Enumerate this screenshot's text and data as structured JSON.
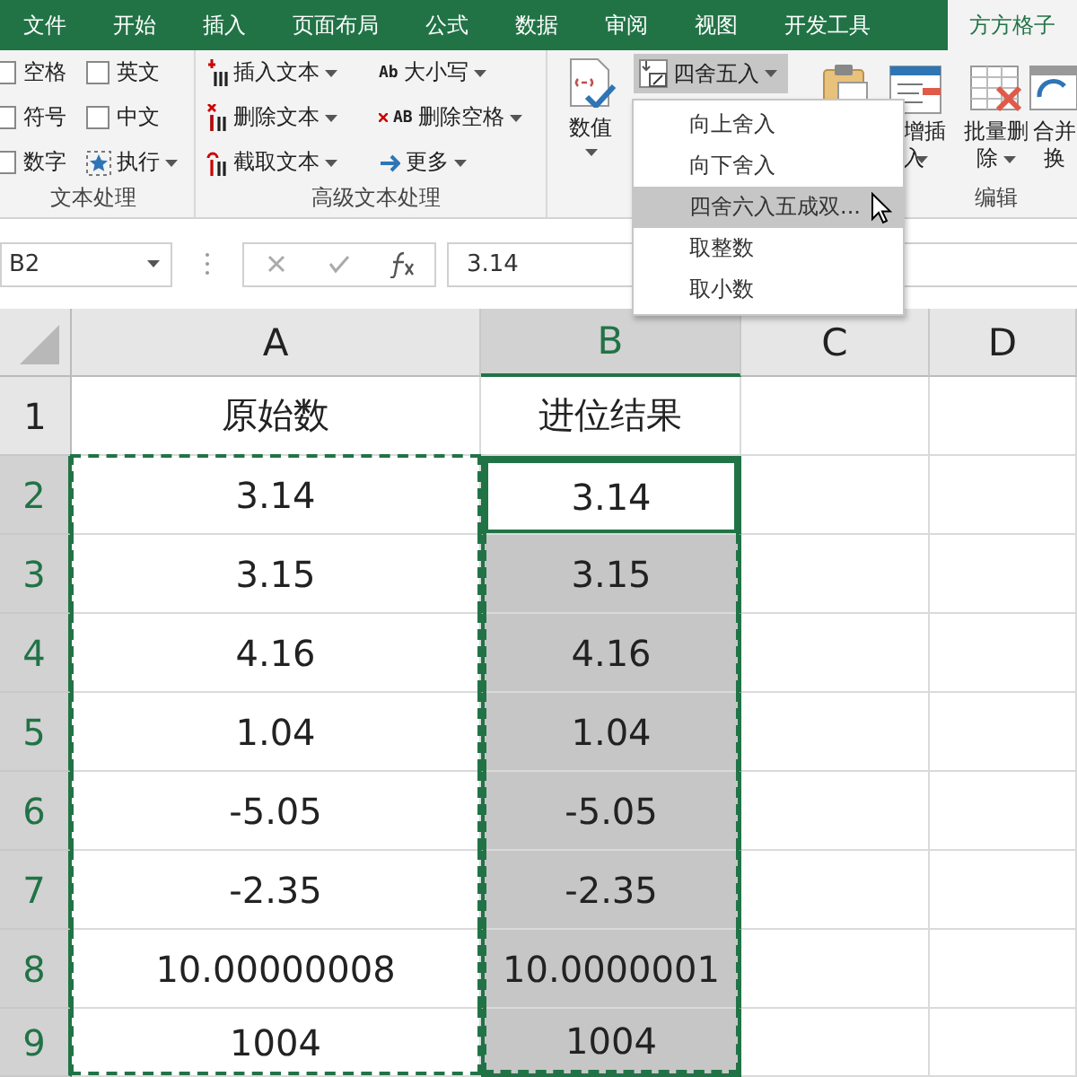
{
  "tabs": [
    {
      "label": "文件",
      "selected": false
    },
    {
      "label": "开始",
      "selected": false
    },
    {
      "label": "插入",
      "selected": false
    },
    {
      "label": "页面布局",
      "selected": false
    },
    {
      "label": "公式",
      "selected": false
    },
    {
      "label": "数据",
      "selected": false
    },
    {
      "label": "审阅",
      "selected": false
    },
    {
      "label": "视图",
      "selected": false
    },
    {
      "label": "开发工具",
      "selected": false
    },
    {
      "label": "方方格子",
      "selected": true
    }
  ],
  "ribbon": {
    "text_group": {
      "label": "文本处理",
      "checkboxes": [
        {
          "label": "空格",
          "checked": false
        },
        {
          "label": "英文",
          "checked": false
        },
        {
          "label": "符号",
          "checked": false
        },
        {
          "label": "中文",
          "checked": false
        },
        {
          "label": "数字",
          "checked": false
        }
      ],
      "execute": "执行"
    },
    "advanced_group": {
      "label": "高级文本处理",
      "commands": [
        {
          "kind": "insert",
          "label": "插入文本"
        },
        {
          "kind": "case",
          "icon_text": "Ab",
          "label": "大小写"
        },
        {
          "kind": "delete",
          "label": "删除文本"
        },
        {
          "kind": "trim",
          "icon_text": "AB",
          "label": "删除空格"
        },
        {
          "kind": "extract",
          "label": "截取文本"
        },
        {
          "kind": "more",
          "label": "更多"
        }
      ]
    },
    "number_group": {
      "value_button": "数值",
      "round_button": {
        "label": "四舍五入",
        "open": true
      }
    },
    "edit_group": {
      "label": "编辑",
      "buttons": [
        {
          "kind": "clipboard"
        },
        {
          "kind": "insert",
          "lines": [
            "增插",
            "入"
          ]
        },
        {
          "kind": "delete",
          "lines": [
            "批量删",
            "除"
          ]
        },
        {
          "kind": "merge",
          "lines": [
            "合并",
            "换"
          ]
        }
      ]
    }
  },
  "menu": [
    {
      "label": "向上舍入",
      "selected": false
    },
    {
      "label": "向下舍入",
      "selected": false
    },
    {
      "label": "四舍六入五成双...",
      "selected": true
    },
    {
      "label": "取整数",
      "selected": false
    },
    {
      "label": "取小数",
      "selected": false
    }
  ],
  "name_box": "B2",
  "formula": "3.14",
  "columns": [
    {
      "label": "A",
      "selected": false
    },
    {
      "label": "B",
      "selected": true
    },
    {
      "label": "C",
      "selected": false
    },
    {
      "label": "D",
      "selected": false
    }
  ],
  "rows": [
    {
      "label": "1",
      "selected": false,
      "cells": [
        {
          "text": "原始数",
          "selected": false,
          "active": false,
          "copied": false
        },
        {
          "text": "进位结果",
          "selected": false,
          "active": false,
          "copied": false
        }
      ]
    },
    {
      "label": "2",
      "selected": true,
      "cells": [
        {
          "text": "3.14",
          "selected": false,
          "active": false,
          "copied": true
        },
        {
          "text": "3.14",
          "selected": true,
          "active": true,
          "copied": true
        }
      ]
    },
    {
      "label": "3",
      "selected": true,
      "cells": [
        {
          "text": "3.15",
          "selected": false,
          "active": false,
          "copied": true
        },
        {
          "text": "3.15",
          "selected": true,
          "active": false,
          "copied": true
        }
      ]
    },
    {
      "label": "4",
      "selected": true,
      "cells": [
        {
          "text": "4.16",
          "selected": false,
          "active": false,
          "copied": true
        },
        {
          "text": "4.16",
          "selected": true,
          "active": false,
          "copied": true
        }
      ]
    },
    {
      "label": "5",
      "selected": true,
      "cells": [
        {
          "text": "1.04",
          "selected": false,
          "active": false,
          "copied": true
        },
        {
          "text": "1.04",
          "selected": true,
          "active": false,
          "copied": true
        }
      ]
    },
    {
      "label": "6",
      "selected": true,
      "cells": [
        {
          "text": "-5.05",
          "selected": false,
          "active": false,
          "copied": true
        },
        {
          "text": "-5.05",
          "selected": true,
          "active": false,
          "copied": true
        }
      ]
    },
    {
      "label": "7",
      "selected": true,
      "cells": [
        {
          "text": "-2.35",
          "selected": false,
          "active": false,
          "copied": true
        },
        {
          "text": "-2.35",
          "selected": true,
          "active": false,
          "copied": true
        }
      ]
    },
    {
      "label": "8",
      "selected": true,
      "cells": [
        {
          "text": "10.00000008",
          "selected": false,
          "active": false,
          "copied": true
        },
        {
          "text": "10.0000001",
          "selected": true,
          "active": false,
          "copied": true
        }
      ]
    },
    {
      "label": "9",
      "selected": true,
      "cells": [
        {
          "text": "1004",
          "selected": false,
          "active": false,
          "copied": true
        },
        {
          "text": "1004",
          "selected": true,
          "active": false,
          "copied": true
        }
      ]
    }
  ]
}
